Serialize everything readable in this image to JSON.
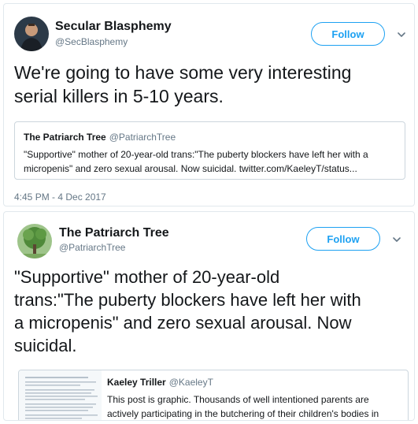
{
  "tweets": [
    {
      "author_name": "Secular Blasphemy",
      "author_handle": "@SecBlasphemy",
      "follow_label": "Follow",
      "text": "We're going to have some very interesting\nserial killers in 5-10 years.",
      "quote": {
        "author_name": "The Patriarch Tree",
        "author_handle": "@PatriarchTree",
        "text": "\"Supportive\" mother of 20-year-old trans:\"The puberty blockers have left her with a\nmicropenis\" and zero sexual arousal. Now suicidal.  twitter.com/KaeleyT/status..."
      },
      "timestamp": "4:45 PM - 4 Dec 2017"
    },
    {
      "author_name": "The Patriarch Tree",
      "author_handle": "@PatriarchTree",
      "follow_label": "Follow",
      "text": "\"Supportive\" mother of 20-year-old\ntrans:\"The puberty blockers have left her with\na micropenis\" and zero sexual arousal. Now\nsuicidal.",
      "quote": {
        "author_name": "Kaeley Triller",
        "author_handle": "@KaeleyT",
        "text": "This post is graphic. Thousands of well intentioned parents are\nactively participating in the butchering of their children's bodies in"
      }
    }
  ],
  "colors": {
    "brand_blue": "#1da1f2",
    "text_primary": "#14171a",
    "text_secondary": "#657786",
    "border": "#e1e8ed"
  },
  "icons": {
    "menu_caret": "chevron-down-icon"
  }
}
